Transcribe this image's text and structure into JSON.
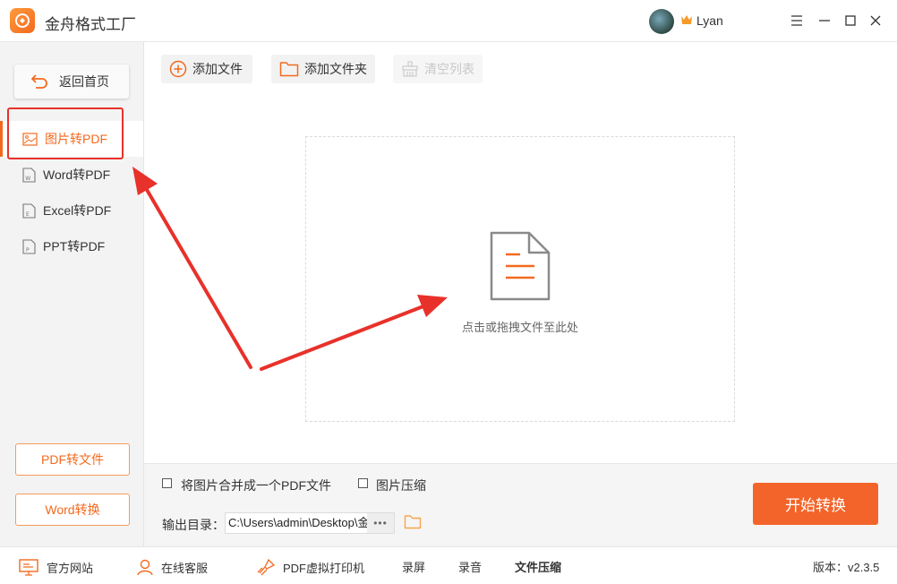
{
  "app": {
    "title": "金舟格式工厂",
    "user_name": "Lyan"
  },
  "sidebar": {
    "back_label": "返回首页",
    "items": [
      {
        "label": "图片转PDF",
        "active": true,
        "icon": "image-icon"
      },
      {
        "label": "Word转PDF",
        "active": false,
        "icon": "word-doc-icon"
      },
      {
        "label": "Excel转PDF",
        "active": false,
        "icon": "excel-doc-icon"
      },
      {
        "label": "PPT转PDF",
        "active": false,
        "icon": "ppt-doc-icon"
      }
    ],
    "bottom_buttons": [
      "PDF转文件",
      "Word转换"
    ]
  },
  "toolbar": {
    "add_file": "添加文件",
    "add_folder": "添加文件夹",
    "clear_list": "清空列表"
  },
  "drop_zone": {
    "hint": "点击或拖拽文件至此处"
  },
  "options": {
    "merge_label": "将图片合并成一个PDF文件",
    "merge_checked": false,
    "compress_label": "图片压缩",
    "compress_checked": false,
    "output_label": "输出目录：",
    "output_path": "C:\\Users\\admin\\Desktop\\金",
    "browse_dots": "•••",
    "start_button": "开始转换"
  },
  "statusbar": {
    "site": "官方网站",
    "support": "在线客服",
    "printer": "PDF虚拟打印机",
    "record_screen": "录屏",
    "record_audio": "录音",
    "file_compress": "文件压缩",
    "version": "版本：v2.3.5"
  },
  "colors": {
    "accent": "#f36a1f",
    "start_button": "#f3642a",
    "annotation": "#e8312a"
  }
}
